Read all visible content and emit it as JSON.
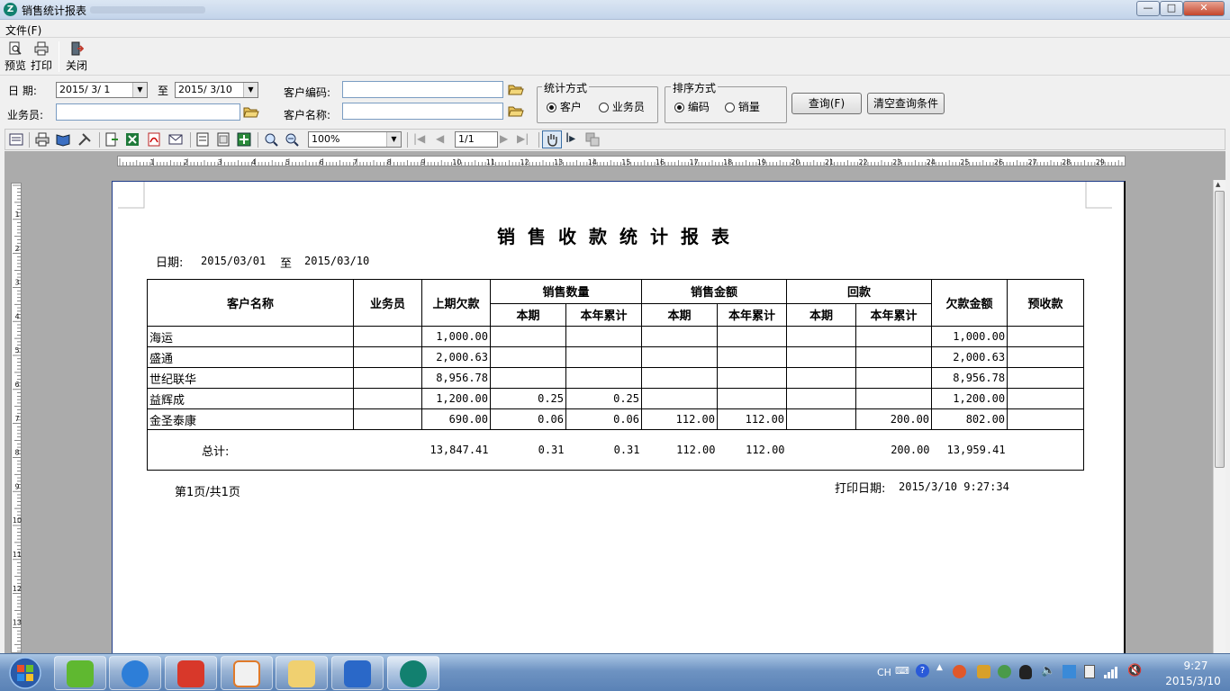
{
  "window": {
    "title": "销售统计报表",
    "minimize_glyph": "—",
    "maximize_glyph": "□",
    "close_glyph": "✕"
  },
  "menu": {
    "file_label": "文件(F)"
  },
  "toolbar": {
    "preview_label": "预览",
    "print_label": "打印",
    "close_label": "关闭"
  },
  "query": {
    "date_label": "日  期:",
    "date_from": "2015/ 3/ 1",
    "to_label": "至",
    "date_to": "2015/ 3/10",
    "salesman_label": "业务员:",
    "salesman_value": "",
    "customer_code_label": "客户编码:",
    "customer_code_value": "",
    "customer_name_label": "客户名称:",
    "customer_name_value": "",
    "stat_group_title": "统计方式",
    "stat_options": [
      {
        "label": "客户",
        "selected": true
      },
      {
        "label": "业务员",
        "selected": false
      }
    ],
    "sort_group_title": "排序方式",
    "sort_options": [
      {
        "label": "编码",
        "selected": true
      },
      {
        "label": "销量",
        "selected": false
      }
    ],
    "query_button": "查询(F)",
    "clear_button": "清空查询条件"
  },
  "preview_toolbar": {
    "zoom": "100%",
    "page": "1/1"
  },
  "ruler": {
    "h_numbers": [
      "1",
      "2",
      "3",
      "4",
      "5",
      "6",
      "7",
      "8",
      "9",
      "10",
      "11",
      "12",
      "13",
      "14",
      "15",
      "16",
      "17",
      "18",
      "19",
      "20",
      "21",
      "22",
      "23",
      "24",
      "25",
      "26",
      "27",
      "28",
      "29"
    ],
    "v_numbers": [
      "1",
      "2",
      "3",
      "4",
      "5",
      "6",
      "7",
      "8",
      "9",
      "10",
      "11",
      "12",
      "13"
    ]
  },
  "report": {
    "title": "销售收款统计报表",
    "date_label": "日期:",
    "date_from": "2015/03/01",
    "to_label": "至",
    "date_to": "2015/03/10",
    "headers": {
      "customer": "客户名称",
      "salesman": "业务员",
      "prev_debt": "上期欠款",
      "sales_qty": "销售数量",
      "sales_amount": "销售金额",
      "payment": "回款",
      "current": "本期",
      "ytd": "本年累计",
      "debt_amount": "欠款金额",
      "prepaid": "预收款"
    },
    "rows": [
      {
        "customer": "海运",
        "salesman": "",
        "prev_debt": "1,000.00",
        "qty_cur": "",
        "qty_ytd": "",
        "amt_cur": "",
        "amt_ytd": "",
        "pay_cur": "",
        "pay_ytd": "",
        "debt": "1,000.00",
        "prepaid": ""
      },
      {
        "customer": "盛通",
        "salesman": "",
        "prev_debt": "2,000.63",
        "qty_cur": "",
        "qty_ytd": "",
        "amt_cur": "",
        "amt_ytd": "",
        "pay_cur": "",
        "pay_ytd": "",
        "debt": "2,000.63",
        "prepaid": ""
      },
      {
        "customer": "世纪联华",
        "salesman": "",
        "prev_debt": "8,956.78",
        "qty_cur": "",
        "qty_ytd": "",
        "amt_cur": "",
        "amt_ytd": "",
        "pay_cur": "",
        "pay_ytd": "",
        "debt": "8,956.78",
        "prepaid": ""
      },
      {
        "customer": "益辉成",
        "salesman": "",
        "prev_debt": "1,200.00",
        "qty_cur": "0.25",
        "qty_ytd": "0.25",
        "amt_cur": "",
        "amt_ytd": "",
        "pay_cur": "",
        "pay_ytd": "",
        "debt": "1,200.00",
        "prepaid": ""
      },
      {
        "customer": "金圣泰康",
        "salesman": "",
        "prev_debt": "690.00",
        "qty_cur": "0.06",
        "qty_ytd": "0.06",
        "amt_cur": "112.00",
        "amt_ytd": "112.00",
        "pay_cur": "",
        "pay_ytd": "200.00",
        "debt": "802.00",
        "prepaid": ""
      }
    ],
    "total": {
      "label": "总计:",
      "prev_debt": "13,847.41",
      "qty_cur": "0.31",
      "qty_ytd": "0.31",
      "amt_cur": "112.00",
      "amt_ytd": "112.00",
      "pay_cur": "",
      "pay_ytd": "200.00",
      "debt": "13,959.41",
      "prepaid": ""
    },
    "page_info": "第1页/共1页",
    "print_date_label": "打印日期:",
    "print_date": "2015/3/10 9:27:34"
  },
  "taskbar": {
    "tray_lang": "CH",
    "clock_time": "9:27",
    "clock_date": "2015/3/10"
  },
  "colors": {
    "app_accent": "#12806f",
    "taskbar": "#6e93c2",
    "report_border": "#1f3c8a"
  }
}
